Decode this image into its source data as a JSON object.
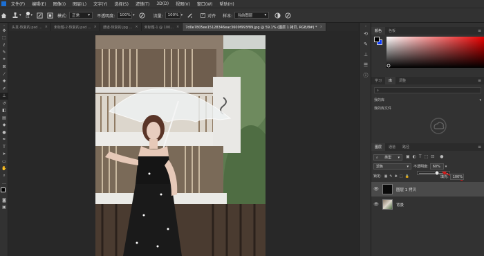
{
  "menubar": {
    "items": [
      "文件(F)",
      "编辑(E)",
      "图像(I)",
      "图层(L)",
      "文字(Y)",
      "选择(S)",
      "滤镜(T)",
      "3D(D)",
      "视图(V)",
      "窗口(W)",
      "帮助(H)"
    ]
  },
  "options": {
    "brush_size": "51",
    "mode_label": "模式:",
    "mode_value": "正常",
    "opacity_label": "不透明度:",
    "opacity_value": "100%",
    "flow_label": "流量:",
    "flow_value": "100%",
    "align_label": "对齐",
    "sample_label": "样本:",
    "sample_value": "当前图层"
  },
  "tabs": [
    {
      "label": "头发-恢复的.psd ...",
      "active": false
    },
    {
      "label": "未标题-2-恢复的.psd ...",
      "active": false
    },
    {
      "label": "通道-恢复的.jpg ...",
      "active": false
    },
    {
      "label": "未标题-1 @ 100...",
      "active": false
    },
    {
      "label": "7d0e7805ee15128346eac3609f993f89.jpg @ 59.1% (图层 1 拷贝, RGB/8#) *",
      "active": true
    }
  ],
  "color_panel": {
    "tabs": [
      "颜色",
      "色板"
    ],
    "accent": "#d41a1a"
  },
  "learn_panel": {
    "tabs": [
      "学习",
      "库",
      "调整"
    ],
    "dropdown": "我的库",
    "link": "我的库文件"
  },
  "layers_panel": {
    "tabs": [
      "图层",
      "通道",
      "路径"
    ],
    "filter": "类型",
    "blend_mode": "滤色",
    "opacity_label": "不透明度:",
    "opacity_value": "60%",
    "lock_label": "锁定:",
    "fill_label": "填充:",
    "fill_value": "100%",
    "layers": [
      {
        "name": "图层 1 拷贝",
        "selected": true
      },
      {
        "name": "背景",
        "selected": false
      }
    ]
  }
}
